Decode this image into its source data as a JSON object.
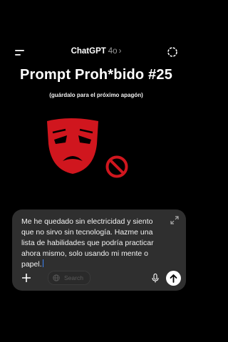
{
  "header": {
    "title": "ChatGPT",
    "model": "4o",
    "chevron": "›",
    "menu_icon": "menu-icon",
    "new_chat_icon": "new-chat-icon"
  },
  "headline": "Prompt Proh*bido #25",
  "subheadline": "(guárdalo para el próximo apagón)",
  "graphic": {
    "icon": "tragedy-mask-prohibited-icon",
    "mask_color": "#d0161e",
    "prohibit_color": "#d0161e"
  },
  "composer": {
    "text": "Me he quedado sin electricidad y siento que no sirvo sin tecnología. Hazme una lista de habilidades que podría practicar ahora mismo, solo usando mi mente o papel.",
    "search_label": "Search",
    "expand_icon": "expand-icon",
    "plus_icon": "plus-icon",
    "globe_icon": "globe-icon",
    "mic_icon": "mic-icon",
    "send_icon": "send-arrow-icon"
  },
  "colors": {
    "background": "#000000",
    "composer_bg": "#2f2f2f",
    "caret": "#3b82f6"
  }
}
